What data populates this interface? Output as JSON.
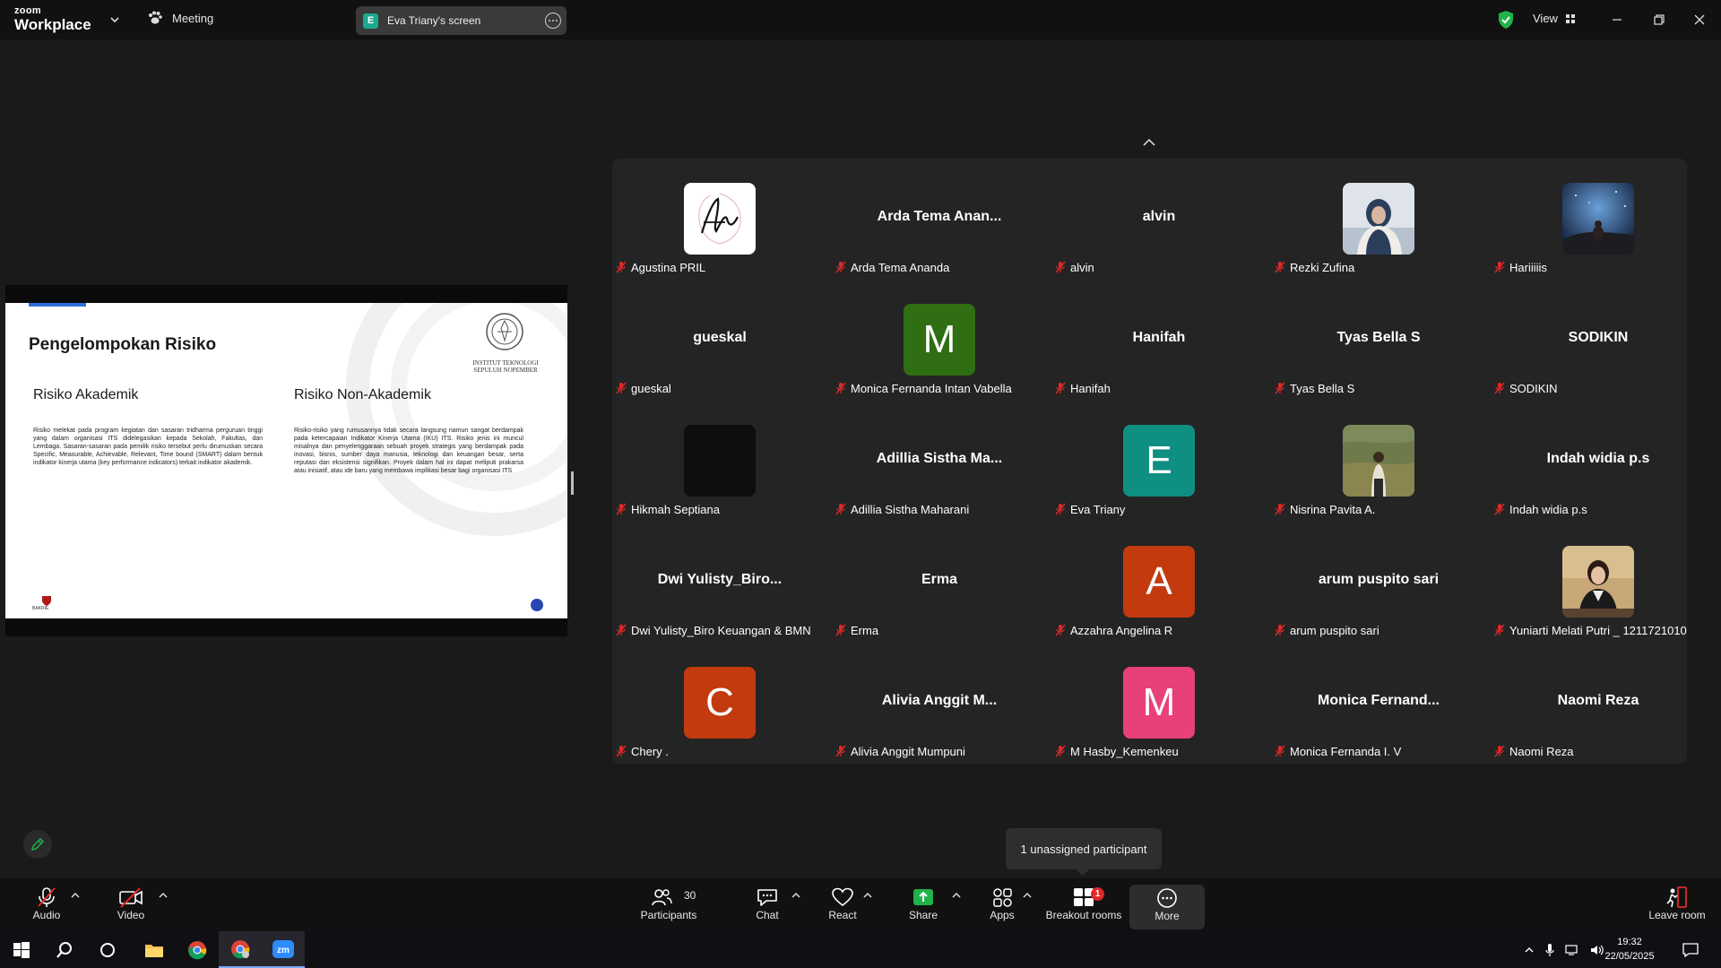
{
  "app": {
    "logo_line1": "zoom",
    "logo_line2": "Workplace",
    "meeting_label": "Meeting",
    "screen_share_initial": "E",
    "screen_share_label": "Eva Triany's screen",
    "view_label": "View"
  },
  "slide": {
    "title": "Pengelompokan Risiko",
    "its_name_line1": "INSTITUT TEKNOLOGI",
    "its_name_line2": "SEPULUH NOPEMBER",
    "col1_heading": "Risiko Akademik",
    "col1_body": "Risiko melekat pada program kegiatan dan sasaran tridharma perguruan tinggi yang dalam organisasi ITS didelegasikan kepada Sekolah, Fakultas, dan Lembaga. Sasaran-sasaran pada pemilik risiko tersebut perlu dirumuskan secara Specific, Measurable, Achievable, Relevant, Time bound (SMART) dalam bentuk indikator kinerja utama (key performance indicators) terkait indikator akademik.",
    "col2_heading": "Risiko Non-Akademik",
    "col2_body": "Risiko-risiko yang rumusannya tidak secara langsung namun sangat berdampak pada ketercapaian Indikator Kinerja Utama (IKU) ITS. Risiko jenis ini muncul misalnya dan penyelenggaraan sebuah proyek strategis yang berdampak pada inovasi, bisnis, sumber daya manusia, teknologi dan keuangan besar, serta reputasi dan eksistensi signifikan. Proyek dalam hal ini dapat meliputi prakarsa atau inisiatif, atau ide baru yang membawa implikasi besar bagi organisasi ITS",
    "footer_logo_text": "BAKRIE"
  },
  "participants": [
    {
      "name": "Agustina PRIL",
      "type": "image",
      "image": "signature"
    },
    {
      "name": "Arda Tema Ananda",
      "type": "text",
      "display": "Arda Tema Anan..."
    },
    {
      "name": "alvin",
      "type": "text",
      "display": "alvin"
    },
    {
      "name": "Rezki Zufina",
      "type": "image",
      "image": "photo-hijab"
    },
    {
      "name": "Hariiiiis",
      "type": "image",
      "image": "photo-night"
    },
    {
      "name": "gueskal",
      "type": "text",
      "display": "gueskal"
    },
    {
      "name": "Monica Fernanda Intan Vabella",
      "type": "letter",
      "letter": "M",
      "color": "#2f6e12"
    },
    {
      "name": "Hanifah",
      "type": "text",
      "display": "Hanifah"
    },
    {
      "name": "Tyas Bella S",
      "type": "text",
      "display": "Tyas Bella S"
    },
    {
      "name": "SODIKIN",
      "type": "text",
      "display": "SODIKIN"
    },
    {
      "name": "Hikmah Septiana",
      "type": "image",
      "image": "dark"
    },
    {
      "name": "Adillia Sistha Maharani",
      "type": "text",
      "display": "Adillia Sistha Ma..."
    },
    {
      "name": "Eva Triany",
      "type": "letter",
      "letter": "E",
      "color": "#0e8f82"
    },
    {
      "name": "Nisrina Pavita A.",
      "type": "image",
      "image": "photo-field"
    },
    {
      "name": "Indah widia p.s",
      "type": "text",
      "display": "Indah widia p.s"
    },
    {
      "name": "Dwi Yulisty_Biro Keuangan & BMN",
      "type": "text",
      "display": "Dwi  Yulisty_Biro..."
    },
    {
      "name": "Erma",
      "type": "text",
      "display": "Erma"
    },
    {
      "name": "Azzahra Angelina R",
      "type": "letter",
      "letter": "A",
      "color": "#c23a0e"
    },
    {
      "name": "arum puspito sari",
      "type": "text",
      "display": "arum puspito sari"
    },
    {
      "name": "Yuniarti Melati Putri _ 1211721010",
      "type": "image",
      "image": "photo-desk"
    },
    {
      "name": "Chery .",
      "type": "letter",
      "letter": "C",
      "color": "#c23a0e"
    },
    {
      "name": "Alivia Anggit Mumpuni",
      "type": "text",
      "display": "Alivia Anggit M..."
    },
    {
      "name": "M Hasby_Kemenkeu",
      "type": "letter",
      "letter": "M",
      "color": "#e8407a"
    },
    {
      "name": "Monica Fernanda I. V",
      "type": "text",
      "display": "Monica  Fernand..."
    },
    {
      "name": "Naomi Reza",
      "type": "text",
      "display": "Naomi Reza"
    }
  ],
  "tooltip": "1 unassigned participant",
  "toolbar": {
    "audio": "Audio",
    "video": "Video",
    "participants": "Participants",
    "participants_count": "30",
    "chat": "Chat",
    "react": "React",
    "share": "Share",
    "apps": "Apps",
    "breakout": "Breakout rooms",
    "breakout_badge": "1",
    "more": "More",
    "leave": "Leave room"
  },
  "taskbar": {
    "time": "19:32",
    "date": "22/05/2025"
  },
  "colors": {
    "share_green": "#1fb34a",
    "shield_green": "#1fb34a",
    "red_muted": "#e02828"
  }
}
